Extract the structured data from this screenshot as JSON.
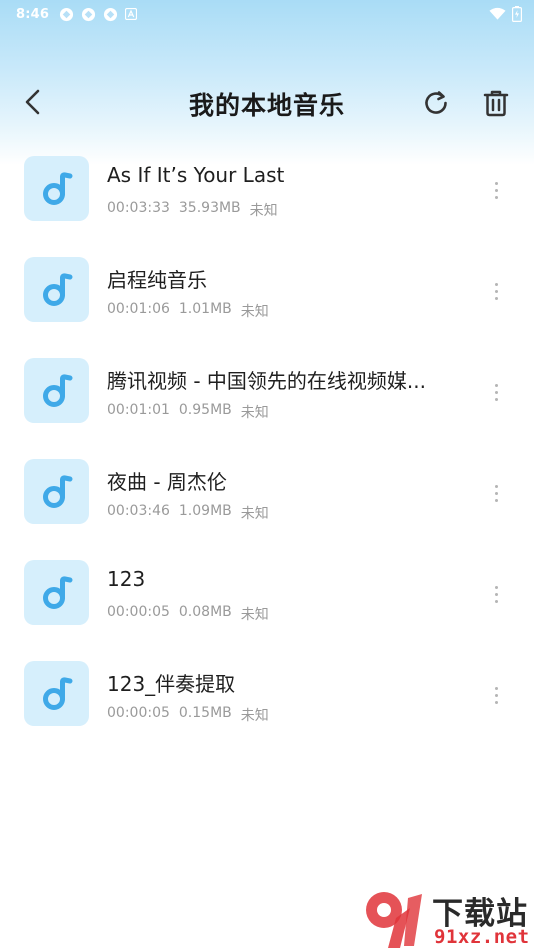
{
  "status_bar": {
    "time": "8:46",
    "icons": [
      "app-icon",
      "app-icon",
      "app-icon",
      "letter-a-icon"
    ],
    "right_icons": [
      "wifi-icon",
      "battery-icon"
    ]
  },
  "header": {
    "title": "我的本地音乐",
    "back_icon": "chevron-left-icon",
    "refresh_icon": "refresh-icon",
    "delete_icon": "trash-icon"
  },
  "songs": [
    {
      "title": "As If It’s Your Last",
      "duration": "00:03:33",
      "size": "35.93MB",
      "artist": "未知"
    },
    {
      "title": "启程纯音乐",
      "duration": "00:01:06",
      "size": "1.01MB",
      "artist": "未知"
    },
    {
      "title": "腾讯视频 - 中国领先的在线视频媒...",
      "duration": "00:01:01",
      "size": "0.95MB",
      "artist": "未知"
    },
    {
      "title": "夜曲 - 周杰伦",
      "duration": "00:03:46",
      "size": "1.09MB",
      "artist": "未知"
    },
    {
      "title": "123",
      "duration": "00:00:05",
      "size": "0.08MB",
      "artist": "未知"
    },
    {
      "title": "123_伴奏提取",
      "duration": "00:00:05",
      "size": "0.15MB",
      "artist": "未知"
    }
  ],
  "watermark": {
    "text_top": "下载站",
    "text_bottom": "91xz.net"
  },
  "colors": {
    "accent": "#3fa9e8",
    "thumb_bg": "#d6effc",
    "header_gradient_top": "#a9dcf6",
    "watermark_red": "#e0343a"
  }
}
